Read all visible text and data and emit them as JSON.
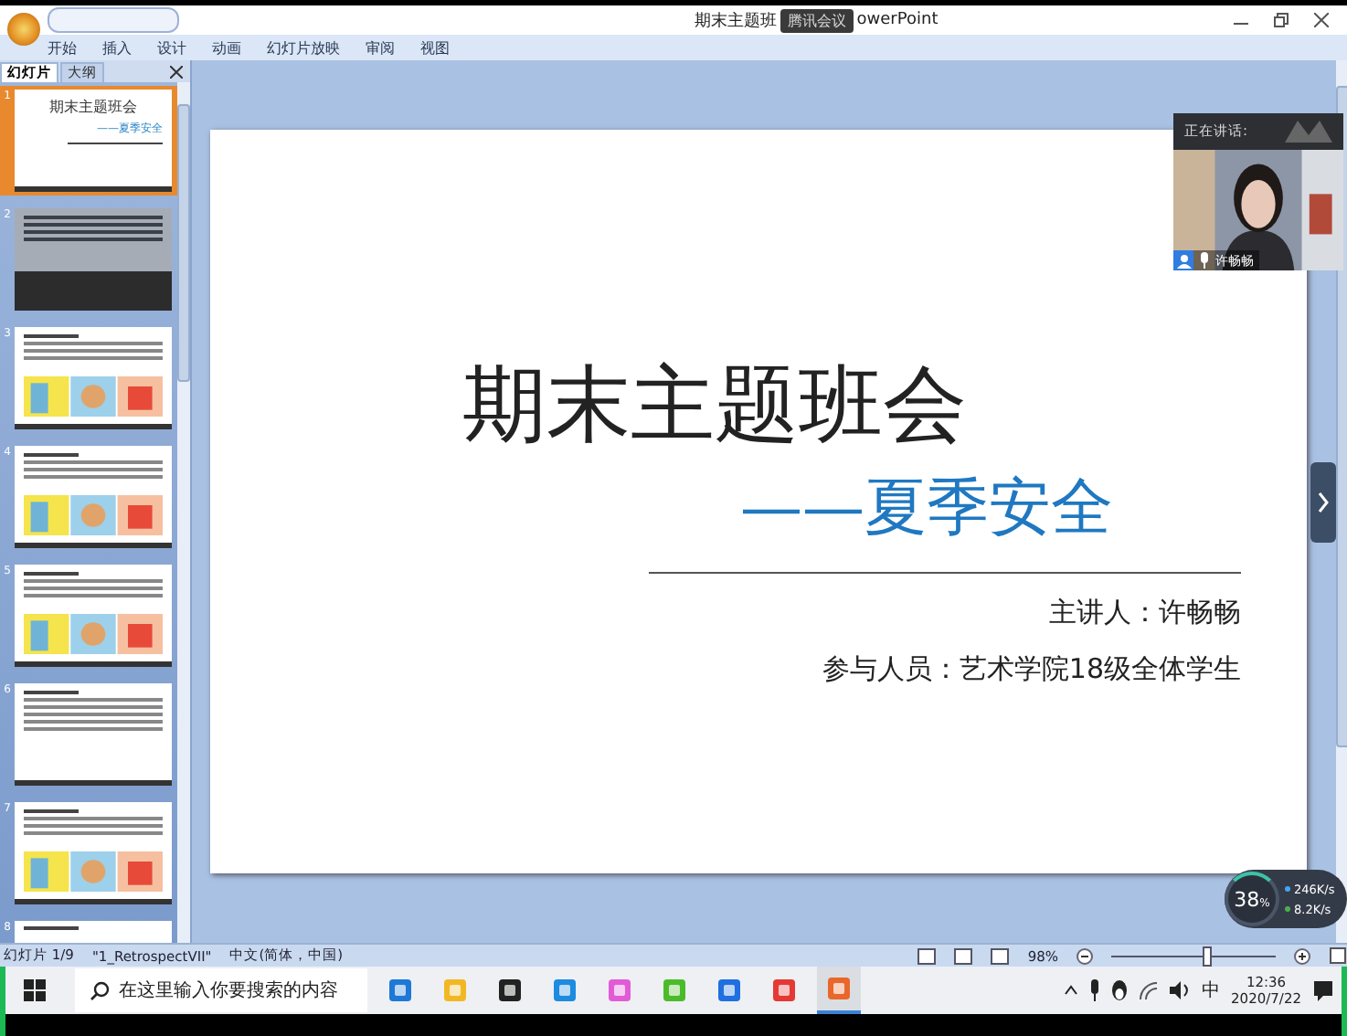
{
  "window": {
    "title_left": "期末主题班",
    "title_right": "owerPoint",
    "share_badge": "腾讯会议"
  },
  "menu": [
    "开始",
    "插入",
    "设计",
    "动画",
    "幻灯片放映",
    "审阅",
    "视图"
  ],
  "panel_tabs": [
    {
      "label": "幻灯片",
      "selected": true
    },
    {
      "label": "大纲",
      "selected": false
    }
  ],
  "slides": [
    {
      "number": "1",
      "selected": true,
      "kind": "title",
      "title": "期末主题班会",
      "subtitle": "——夏季安全"
    },
    {
      "number": "2",
      "selected": false,
      "kind": "dark"
    },
    {
      "number": "3",
      "selected": false,
      "kind": "illustrated"
    },
    {
      "number": "4",
      "selected": false,
      "kind": "illustrated"
    },
    {
      "number": "5",
      "selected": false,
      "kind": "illustrated"
    },
    {
      "number": "6",
      "selected": false,
      "kind": "text"
    },
    {
      "number": "7",
      "selected": false,
      "kind": "illustrated"
    },
    {
      "number": "8",
      "selected": false,
      "kind": "partial"
    }
  ],
  "slide": {
    "title": "期末主题班会",
    "subtitle": "——夏季安全",
    "speaker": "主讲人：许畅畅",
    "audience": "参与人员：艺术学院18级全体学生"
  },
  "video": {
    "header": "正在讲话:",
    "name": "许畅畅"
  },
  "network": {
    "percent": "38",
    "unit": "%",
    "up": "246K/s",
    "down": "8.2K/s"
  },
  "status_bar": {
    "slide": "幻灯片 1/9",
    "theme": "\"1_RetrospectVII\"",
    "language": "中文(简体，中国)",
    "zoom": "98%",
    "level": 0.55
  },
  "taskbar": {
    "search": {
      "placeholder": "在这里输入你要搜索的内容"
    },
    "ime": "中",
    "time": "12:36",
    "date": "2020/7/22"
  }
}
